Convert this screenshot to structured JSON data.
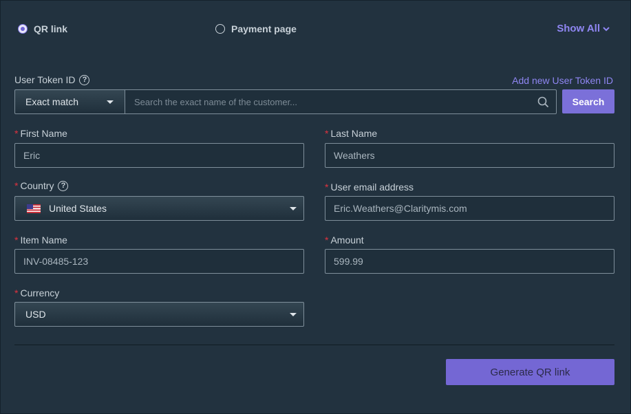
{
  "link_type": {
    "options": [
      {
        "label": "QR link",
        "selected": true
      },
      {
        "label": "Payment page",
        "selected": false
      }
    ],
    "show_all": "Show All"
  },
  "user_token": {
    "label": "User Token ID",
    "add_new_link": "Add new User Token ID",
    "match_mode": "Exact match",
    "search_placeholder": "Search the exact name of the customer...",
    "search_button": "Search"
  },
  "form": {
    "first_name": {
      "label": "First Name",
      "value": "Eric"
    },
    "last_name": {
      "label": "Last Name",
      "value": "Weathers"
    },
    "country": {
      "label": "Country",
      "value": "United States",
      "flag": "us-flag-icon"
    },
    "email": {
      "label": "User email address",
      "value": "Eric.Weathers@Claritymis.com"
    },
    "item_name": {
      "label": "Item Name",
      "value": "INV-08485-123"
    },
    "amount": {
      "label": "Amount",
      "value": "599.99"
    },
    "currency": {
      "label": "Currency",
      "value": "USD"
    },
    "required_marker": "*"
  },
  "actions": {
    "generate_label": "Generate QR link"
  },
  "colors": {
    "accent": "#7b70d9",
    "link": "#8f86f2",
    "required": "#e0323f",
    "background": "#22323f"
  }
}
